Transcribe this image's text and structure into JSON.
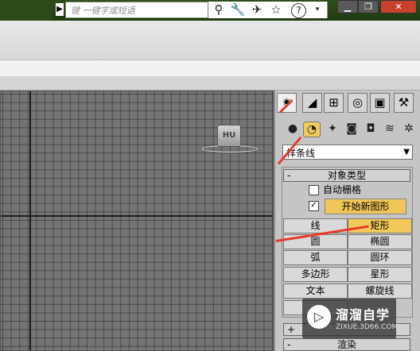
{
  "browser": {
    "search_placeholder": "键    一键字或短语",
    "tool_icons": [
      "binoculars-icon",
      "wrench-icon",
      "satellite-icon",
      "star-icon",
      "help-icon"
    ],
    "window_buttons": [
      "minimize",
      "restore",
      "close"
    ]
  },
  "viewport": {
    "cube_label": "HU"
  },
  "command_panel": {
    "tabs": [
      "create-tab",
      "modify-tab",
      "hierarchy-tab",
      "motion-tab",
      "display-tab",
      "utilities-tab"
    ],
    "category_icons": [
      "geometry-icon",
      "shapes-icon",
      "lights-icon",
      "cameras-icon",
      "helpers-icon",
      "spacewarps-icon",
      "systems-icon"
    ],
    "dropdown_value": "样条线",
    "object_type": {
      "sign": "-",
      "header": "对象类型",
      "auto_grid_label": "自动栅格",
      "start_new_shape_label": "开始新图形",
      "start_new_checked": "✓",
      "buttons": [
        {
          "label": "线",
          "active": false
        },
        {
          "label": "矩形",
          "active": true
        },
        {
          "label": "圆",
          "active": false
        },
        {
          "label": "椭圆",
          "active": false
        },
        {
          "label": "弧",
          "active": false
        },
        {
          "label": "圆环",
          "active": false
        },
        {
          "label": "多边形",
          "active": false
        },
        {
          "label": "星形",
          "active": false
        },
        {
          "label": "文本",
          "active": false
        },
        {
          "label": "螺旋线",
          "active": false
        }
      ]
    },
    "name_color": {
      "sign": "+"
    },
    "render": {
      "sign": "-",
      "header": "渲染"
    }
  },
  "watermark": {
    "title": "溜溜自学",
    "url": "ZIXUE.3D66.COM"
  },
  "colors": {
    "highlight": "#f3c95c",
    "arrow": "#e83a2a",
    "titlebar": "#2b4a18"
  }
}
